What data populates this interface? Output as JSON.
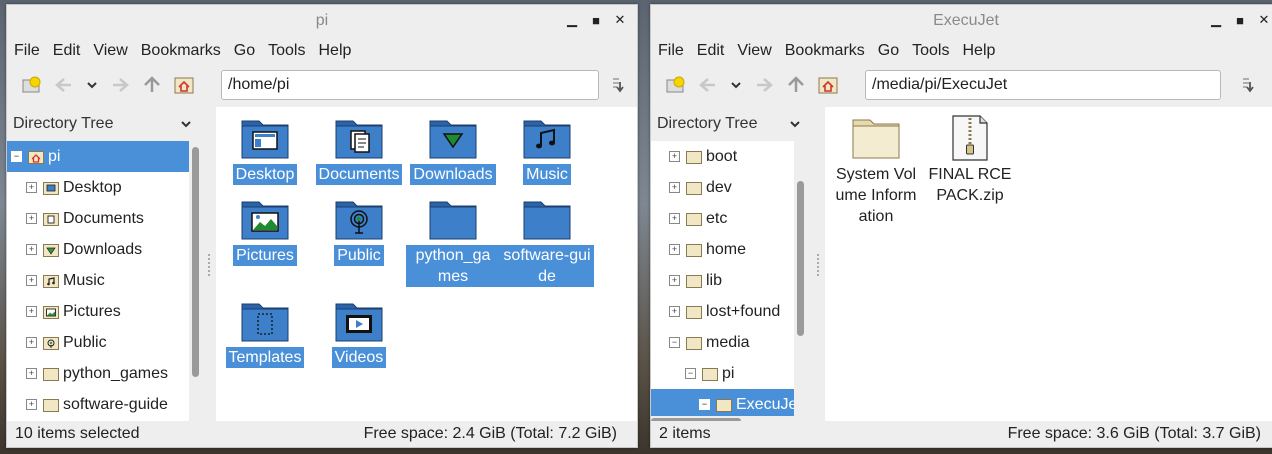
{
  "left_window": {
    "title": "pi",
    "menu": [
      "File",
      "Edit",
      "View",
      "Bookmarks",
      "Go",
      "Tools",
      "Help"
    ],
    "path": "/home/pi",
    "side_header": "Directory Tree",
    "tree": [
      {
        "label": "pi",
        "expander": "−",
        "icon": "home-folder-icon",
        "selected": true
      },
      {
        "label": "Desktop",
        "expander": "+",
        "icon": "desktop-folder-icon"
      },
      {
        "label": "Documents",
        "expander": "+",
        "icon": "documents-folder-icon"
      },
      {
        "label": "Downloads",
        "expander": "+",
        "icon": "downloads-folder-icon"
      },
      {
        "label": "Music",
        "expander": "+",
        "icon": "music-folder-icon"
      },
      {
        "label": "Pictures",
        "expander": "+",
        "icon": "pictures-folder-icon"
      },
      {
        "label": "Public",
        "expander": "+",
        "icon": "public-folder-icon"
      },
      {
        "label": "python_games",
        "expander": "+",
        "icon": "folder-icon"
      },
      {
        "label": "software-guide",
        "expander": "+",
        "icon": "folder-icon"
      }
    ],
    "items": [
      {
        "label": "Desktop",
        "icon": "desktop-folder-icon"
      },
      {
        "label": "Documents",
        "icon": "documents-folder-icon"
      },
      {
        "label": "Downloads",
        "icon": "downloads-folder-icon"
      },
      {
        "label": "Music",
        "icon": "music-folder-icon"
      },
      {
        "label": "Pictures",
        "icon": "pictures-folder-icon"
      },
      {
        "label": "Public",
        "icon": "public-folder-icon"
      },
      {
        "label": "python_games",
        "icon": "folder-icon"
      },
      {
        "label": "software-guide",
        "icon": "folder-icon"
      },
      {
        "label": "Templates",
        "icon": "templates-folder-icon"
      },
      {
        "label": "Videos",
        "icon": "videos-folder-icon"
      }
    ],
    "status_left": "10 items selected",
    "status_right": "Free space: 2.4 GiB (Total: 7.2 GiB)"
  },
  "right_window": {
    "title": "ExecuJet",
    "menu": [
      "File",
      "Edit",
      "View",
      "Bookmarks",
      "Go",
      "Tools",
      "Help"
    ],
    "path": "/media/pi/ExecuJet",
    "side_header": "Directory Tree",
    "tree": [
      {
        "label": "boot",
        "expander": "+",
        "indent": 0
      },
      {
        "label": "dev",
        "expander": "+",
        "indent": 0
      },
      {
        "label": "etc",
        "expander": "+",
        "indent": 0
      },
      {
        "label": "home",
        "expander": "+",
        "indent": 0
      },
      {
        "label": "lib",
        "expander": "+",
        "indent": 0
      },
      {
        "label": "lost+found",
        "expander": "+",
        "indent": 0
      },
      {
        "label": "media",
        "expander": "−",
        "indent": 0
      },
      {
        "label": "pi",
        "expander": "−",
        "indent": 1
      },
      {
        "label": "ExecuJet",
        "expander": "−",
        "indent": 2,
        "selected": true
      }
    ],
    "items": [
      {
        "label": "System Volume Information",
        "icon": "folder-icon"
      },
      {
        "label": "FINAL RCE PACK.zip",
        "icon": "zip-archive-icon"
      }
    ],
    "status_left": "2 items",
    "status_right": "Free space: 3.6 GiB (Total: 3.7 GiB)"
  },
  "colors": {
    "selection": "#4a90d9",
    "folder_blue": "#3d7fc9",
    "folder_beige": "#f1e7c4"
  }
}
